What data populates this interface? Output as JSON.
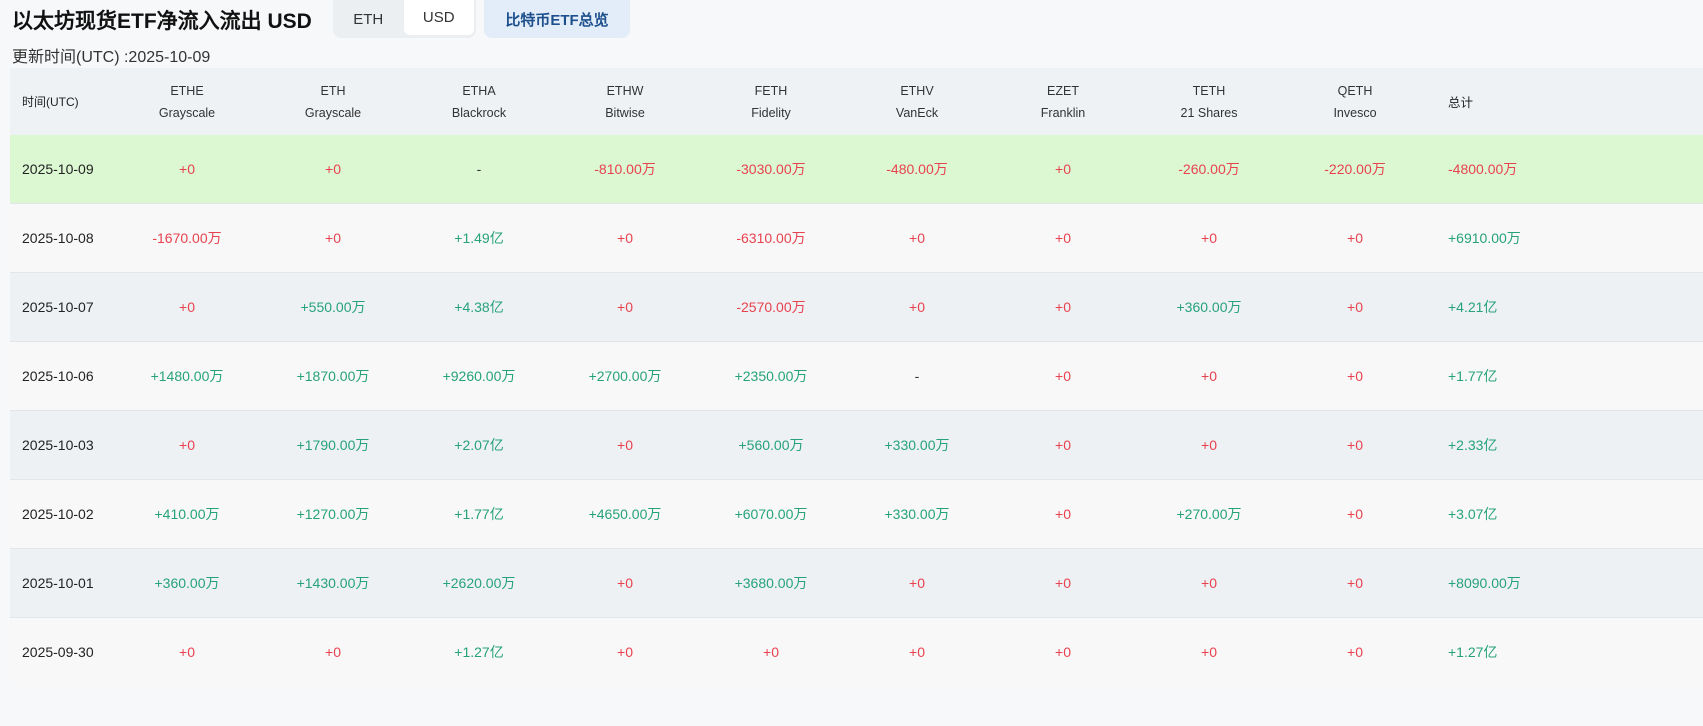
{
  "header": {
    "title": "以太坊现货ETF净流入流出 USD",
    "toggle": [
      {
        "label": "ETH",
        "active": false
      },
      {
        "label": "USD",
        "active": true
      }
    ],
    "btc_button": "比特币ETF总览",
    "updated": "更新时间(UTC) :2025-10-09"
  },
  "colors": {
    "negative": "#e8424f",
    "positive": "#26a27b",
    "highlight_row": "#dcf8d2"
  },
  "table": {
    "date_header": "时间(UTC)",
    "total_header": "总计",
    "columns": [
      {
        "ticker": "ETHE",
        "issuer": "Grayscale"
      },
      {
        "ticker": "ETH",
        "issuer": "Grayscale"
      },
      {
        "ticker": "ETHA",
        "issuer": "Blackrock"
      },
      {
        "ticker": "ETHW",
        "issuer": "Bitwise"
      },
      {
        "ticker": "FETH",
        "issuer": "Fidelity"
      },
      {
        "ticker": "ETHV",
        "issuer": "VanEck"
      },
      {
        "ticker": "EZET",
        "issuer": "Franklin"
      },
      {
        "ticker": "TETH",
        "issuer": "21 Shares"
      },
      {
        "ticker": "QETH",
        "issuer": "Invesco"
      }
    ],
    "rows": [
      {
        "date": "2025-10-09",
        "values": [
          "+0",
          "+0",
          "-",
          "-810.00万",
          "-3030.00万",
          "-480.00万",
          "+0",
          "-260.00万",
          "-220.00万"
        ],
        "total": "-4800.00万"
      },
      {
        "date": "2025-10-08",
        "values": [
          "-1670.00万",
          "+0",
          "+1.49亿",
          "+0",
          "-6310.00万",
          "+0",
          "+0",
          "+0",
          "+0"
        ],
        "total": "+6910.00万"
      },
      {
        "date": "2025-10-07",
        "values": [
          "+0",
          "+550.00万",
          "+4.38亿",
          "+0",
          "-2570.00万",
          "+0",
          "+0",
          "+360.00万",
          "+0"
        ],
        "total": "+4.21亿"
      },
      {
        "date": "2025-10-06",
        "values": [
          "+1480.00万",
          "+1870.00万",
          "+9260.00万",
          "+2700.00万",
          "+2350.00万",
          "-",
          "+0",
          "+0",
          "+0"
        ],
        "total": "+1.77亿"
      },
      {
        "date": "2025-10-03",
        "values": [
          "+0",
          "+1790.00万",
          "+2.07亿",
          "+0",
          "+560.00万",
          "+330.00万",
          "+0",
          "+0",
          "+0"
        ],
        "total": "+2.33亿"
      },
      {
        "date": "2025-10-02",
        "values": [
          "+410.00万",
          "+1270.00万",
          "+1.77亿",
          "+4650.00万",
          "+6070.00万",
          "+330.00万",
          "+0",
          "+270.00万",
          "+0"
        ],
        "total": "+3.07亿"
      },
      {
        "date": "2025-10-01",
        "values": [
          "+360.00万",
          "+1430.00万",
          "+2620.00万",
          "+0",
          "+3680.00万",
          "+0",
          "+0",
          "+0",
          "+0"
        ],
        "total": "+8090.00万"
      },
      {
        "date": "2025-09-30",
        "values": [
          "+0",
          "+0",
          "+1.27亿",
          "+0",
          "+0",
          "+0",
          "+0",
          "+0",
          "+0"
        ],
        "total": "+1.27亿"
      }
    ]
  }
}
